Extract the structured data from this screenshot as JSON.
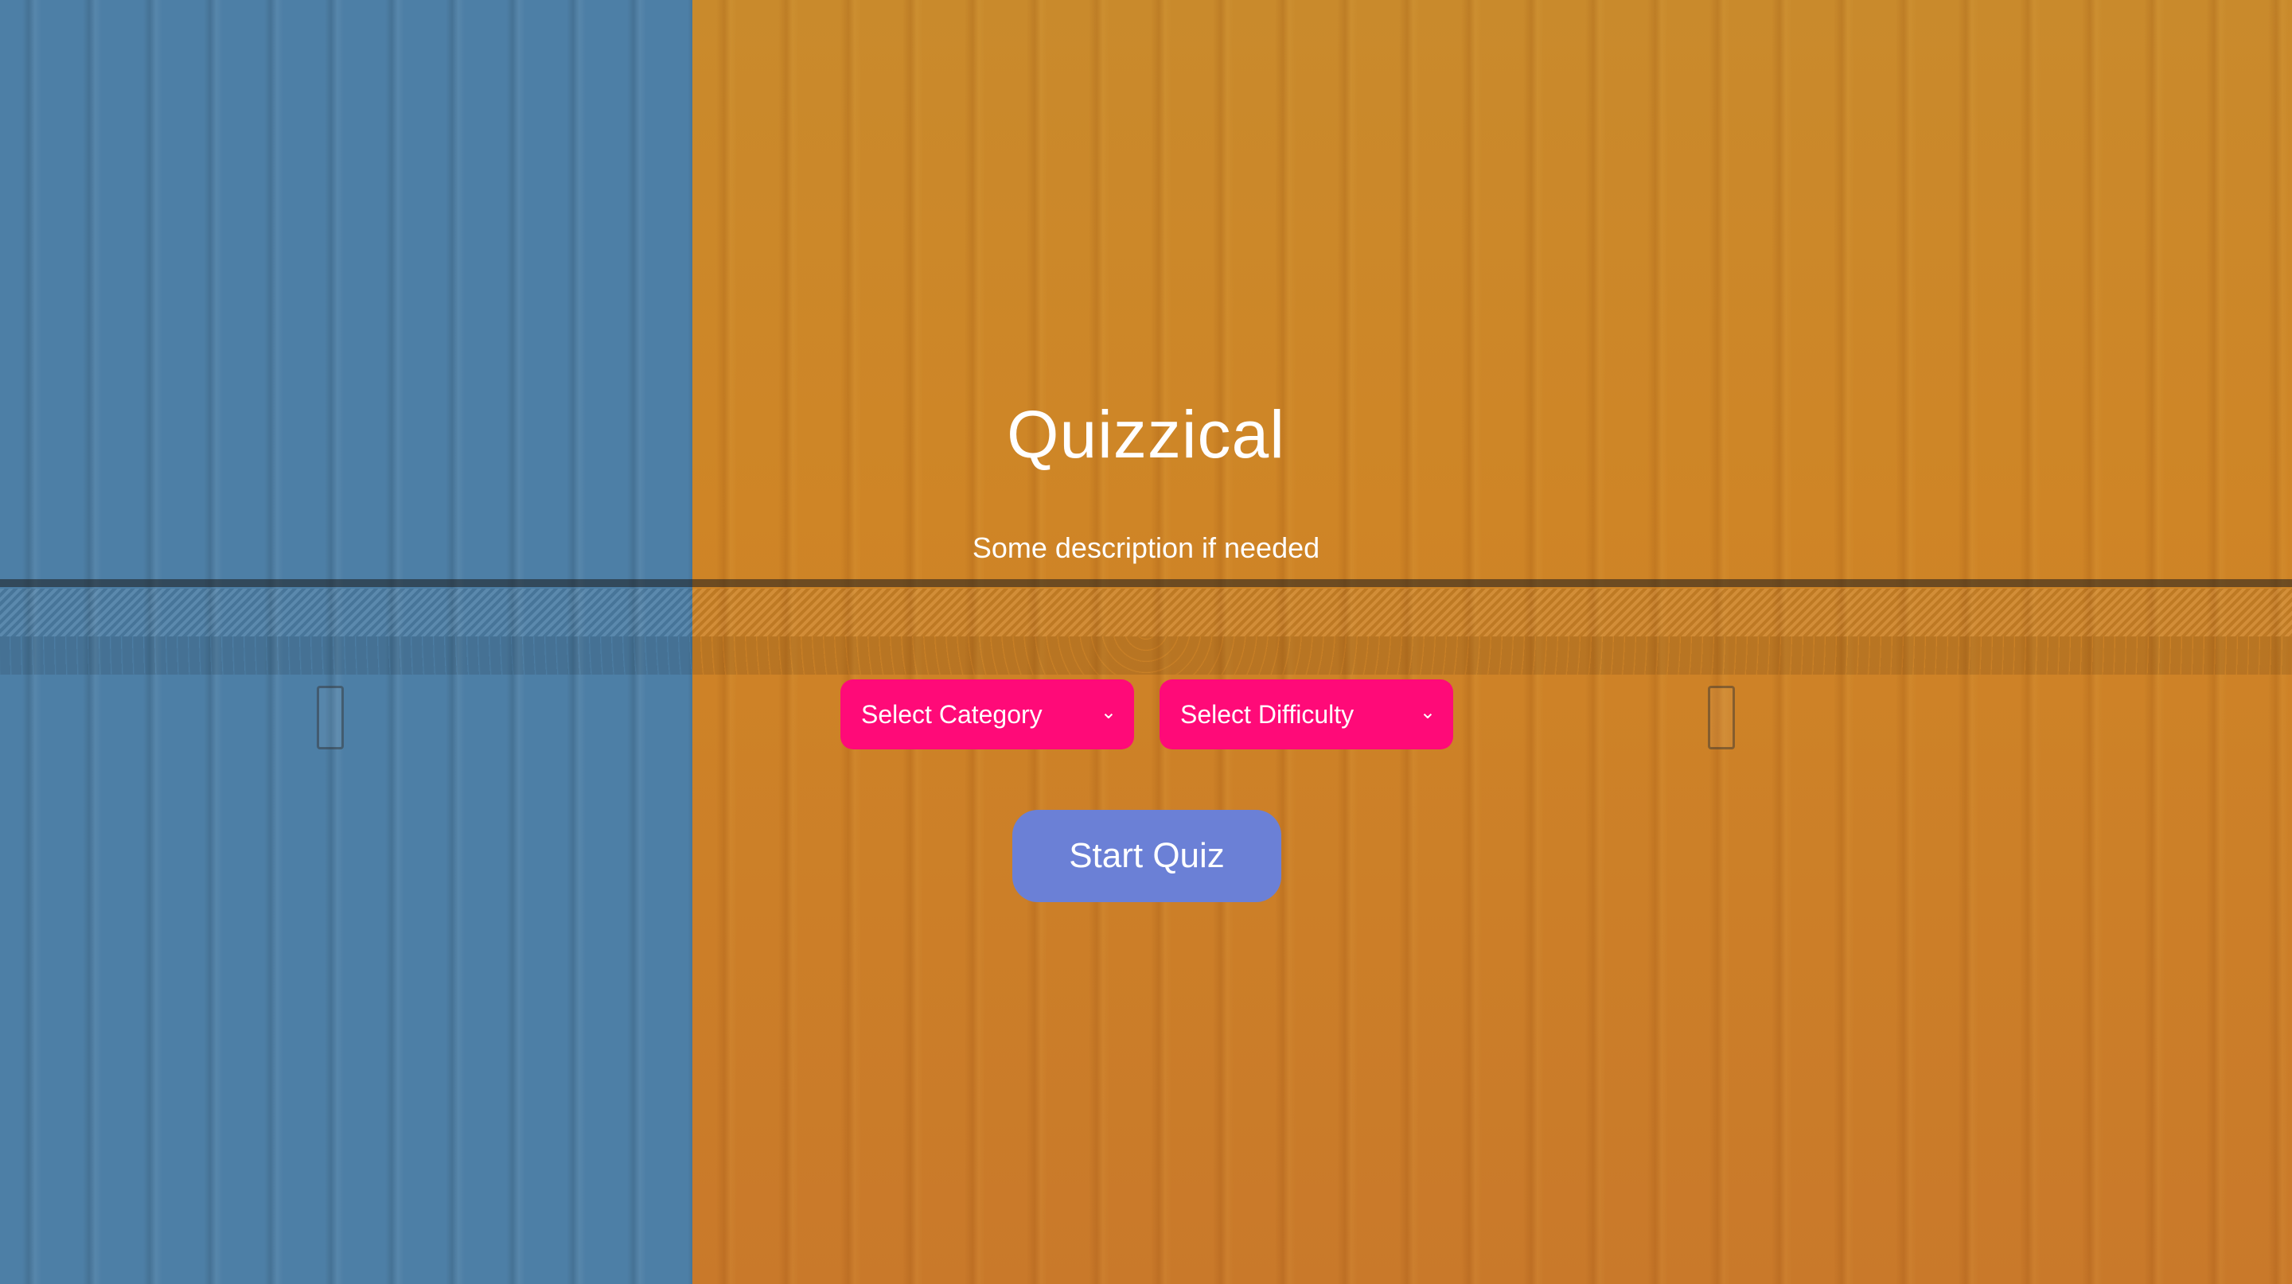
{
  "app": {
    "title": "Quizzical",
    "description": "Some description if needed"
  },
  "controls": {
    "category_select": {
      "selected": "Select Category"
    },
    "difficulty_select": {
      "selected": "Select Difficulty"
    },
    "start_button": {
      "label": "Start Quiz"
    }
  },
  "icons": {
    "select_chevron": "chevron-down-icon"
  },
  "colors": {
    "select_bg": "#ff0a78",
    "button_bg": "#6b80d6",
    "text": "#ffffff",
    "bg_left": "#4d7fa6",
    "bg_right": "#cf8526"
  }
}
